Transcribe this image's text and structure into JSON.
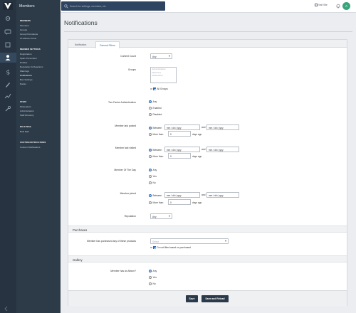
{
  "app": {
    "title": "Members"
  },
  "sidebar": {
    "sections": [
      {
        "heading": "MEMBERS",
        "items": [
          "Members",
          "Groups",
          "Group Promotions",
          "IP Address Tools"
        ]
      },
      {
        "heading": "MEMBER SETTINGS",
        "items": [
          "Registration",
          "Spam Prevention",
          "Profiles",
          "Reputation & Reactions",
          "Warnings",
          "Notifications",
          "Ban Settings",
          "Ranks"
        ]
      },
      {
        "heading": "STAFF",
        "items": [
          "Moderators",
          "Administrators",
          "Staff Directory"
        ]
      },
      {
        "heading": "BULK MAIL",
        "items": [
          "Bulk Mail"
        ]
      },
      {
        "heading": "CUSTOM NOTIFICATIONS",
        "items": [
          "Custom Notifications"
        ]
      }
    ]
  },
  "topbar": {
    "search_placeholder": "Search for settings, members, etc",
    "visit_site": "Visit Site",
    "avatar_letter": "A"
  },
  "page": {
    "title": "Notifications"
  },
  "tabs": [
    {
      "label": "Notification",
      "active": false
    },
    {
      "label": "General Filters",
      "active": true
    }
  ],
  "form": {
    "content_count": {
      "label": "Content Count",
      "value": "Any"
    },
    "groups": {
      "label": "Groups",
      "options": [
        "Administrators",
        "Members",
        "Moderators"
      ],
      "and_text": "or",
      "all_groups": "All Groups"
    },
    "two_factor": {
      "label": "Two Factor Authentication",
      "options": [
        "Any",
        "Enabled",
        "Disabled"
      ]
    },
    "last_posted": {
      "label": "Member last posted",
      "between": "Between",
      "date_placeholder": "mm / dd / yyyy",
      "and": "and",
      "more_than": "More than",
      "days_value": "0",
      "days_ago": "days ago"
    },
    "last_visited": {
      "label": "Member last visited",
      "between": "Between",
      "date_placeholder": "mm / dd / yyyy",
      "and": "and",
      "more_than": "More than",
      "days_value": "0",
      "days_ago": "days ago"
    },
    "member_of_day": {
      "label": "Member Of The Day",
      "options": [
        "Any",
        "Yes",
        "No"
      ]
    },
    "member_joined": {
      "label": "Member joined",
      "between": "Between",
      "date_placeholder": "mm / dd / yyyy",
      "and": "and",
      "more_than": "More than",
      "days_value": "0",
      "days_ago": "days ago"
    },
    "reputation": {
      "label": "Reputation",
      "value": "Any"
    }
  },
  "purchases": {
    "heading": "Purchases",
    "label": "Member has purchased any of these products",
    "placeholder": "Select",
    "or_text": "or",
    "no_filter": "Do not filter based on purchased"
  },
  "gallery": {
    "heading": "Gallery",
    "label": "Member has an Album?",
    "options": [
      "Any",
      "Yes",
      "No"
    ]
  },
  "actions": {
    "save": "Save",
    "save_reload": "Save and Reload"
  },
  "colors": {
    "sidebar": "#273340",
    "menu": "#2d3b49",
    "search": "#2e4460",
    "accent": "#2e6cb1",
    "button": "#2b3a4a"
  }
}
